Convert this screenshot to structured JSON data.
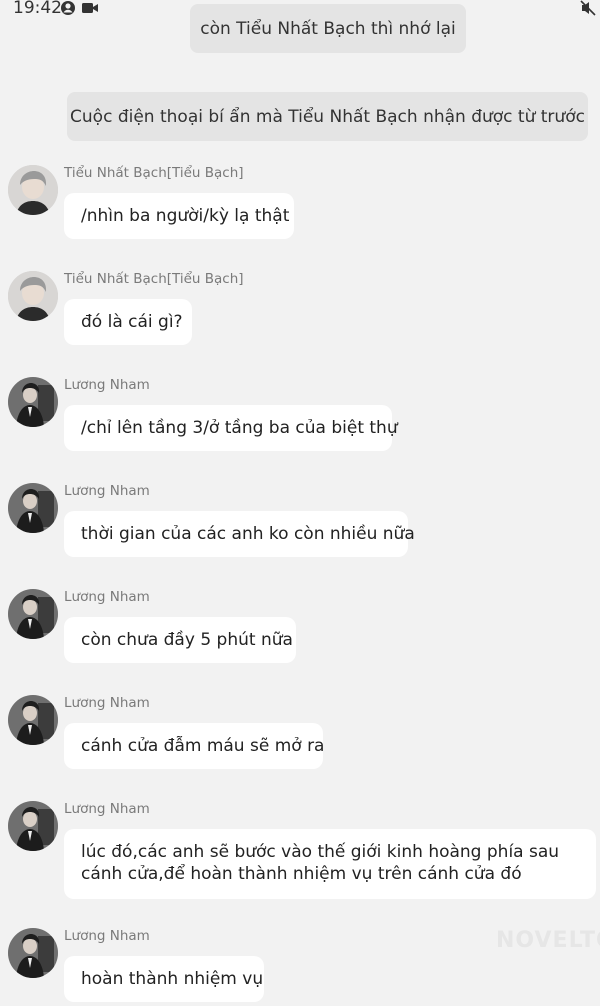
{
  "status_bar": {
    "time": "19:42",
    "icons": [
      "account-circle-icon",
      "video-camera-icon",
      "mute-icon"
    ]
  },
  "narrations": [
    "còn Tiểu Nhất Bạch thì nhớ lại",
    "Cuộc điện thoại bí ẩn mà Tiểu Nhất Bạch nhận được từ trước"
  ],
  "messages": [
    {
      "sender": "Tiểu Nhất Bạch[Tiểu Bạch]",
      "avatar": "white-hair-avatar",
      "text": "/nhìn ba người/kỳ lạ thật"
    },
    {
      "sender": "Tiểu Nhất Bạch[Tiểu Bạch]",
      "avatar": "white-hair-avatar",
      "text": "đó là cái gì?"
    },
    {
      "sender": "Lương Nham",
      "avatar": "dark-suit-avatar",
      "text": "/chỉ lên tầng 3/ở tầng ba của biệt thự"
    },
    {
      "sender": "Lương Nham",
      "avatar": "dark-suit-avatar",
      "text": "thời gian của các anh ko còn nhiều nữa"
    },
    {
      "sender": "Lương Nham",
      "avatar": "dark-suit-avatar",
      "text": "còn chưa đầy 5 phút nữa"
    },
    {
      "sender": "Lương Nham",
      "avatar": "dark-suit-avatar",
      "text": "cánh cửa đẫm máu sẽ mở ra"
    },
    {
      "sender": "Lương Nham",
      "avatar": "dark-suit-avatar",
      "text": "lúc đó,các anh sẽ bước vào thế giới kinh hoàng phía sau cánh cửa,để hoàn thành nhiệm vụ trên cánh cửa đó"
    },
    {
      "sender": "Lương Nham",
      "avatar": "dark-suit-avatar",
      "text": "hoàn thành nhiệm vụ"
    }
  ],
  "watermark": "NOVELTO"
}
